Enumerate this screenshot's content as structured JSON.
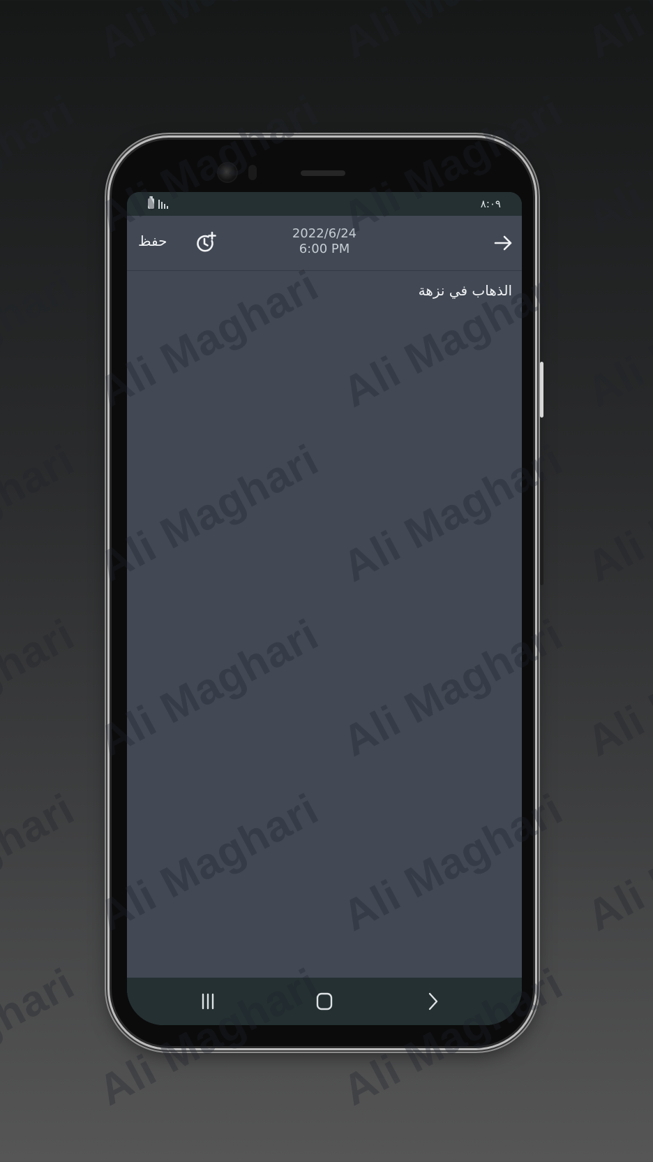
{
  "watermark": {
    "text": "Ali Maghari"
  },
  "status_bar": {
    "time": "٨:٠٩",
    "battery_icon": "battery-icon",
    "signal_icon": "signal-icon"
  },
  "header": {
    "save_label": "حفظ",
    "date": "2022/6/24",
    "time": "6:00 PM",
    "alarm_icon": "add-alarm-icon",
    "back_icon": "arrow-right-icon"
  },
  "note": {
    "text": "الذهاب في نزهة"
  },
  "nav_bar": {
    "recents_icon": "recents-icon",
    "home_icon": "home-icon",
    "back_icon": "back-chevron-icon"
  },
  "colors": {
    "screen_bg": "#424954",
    "bars_bg": "#243032",
    "text": "#f1f3f5",
    "muted_text": "#c7cdd3"
  }
}
